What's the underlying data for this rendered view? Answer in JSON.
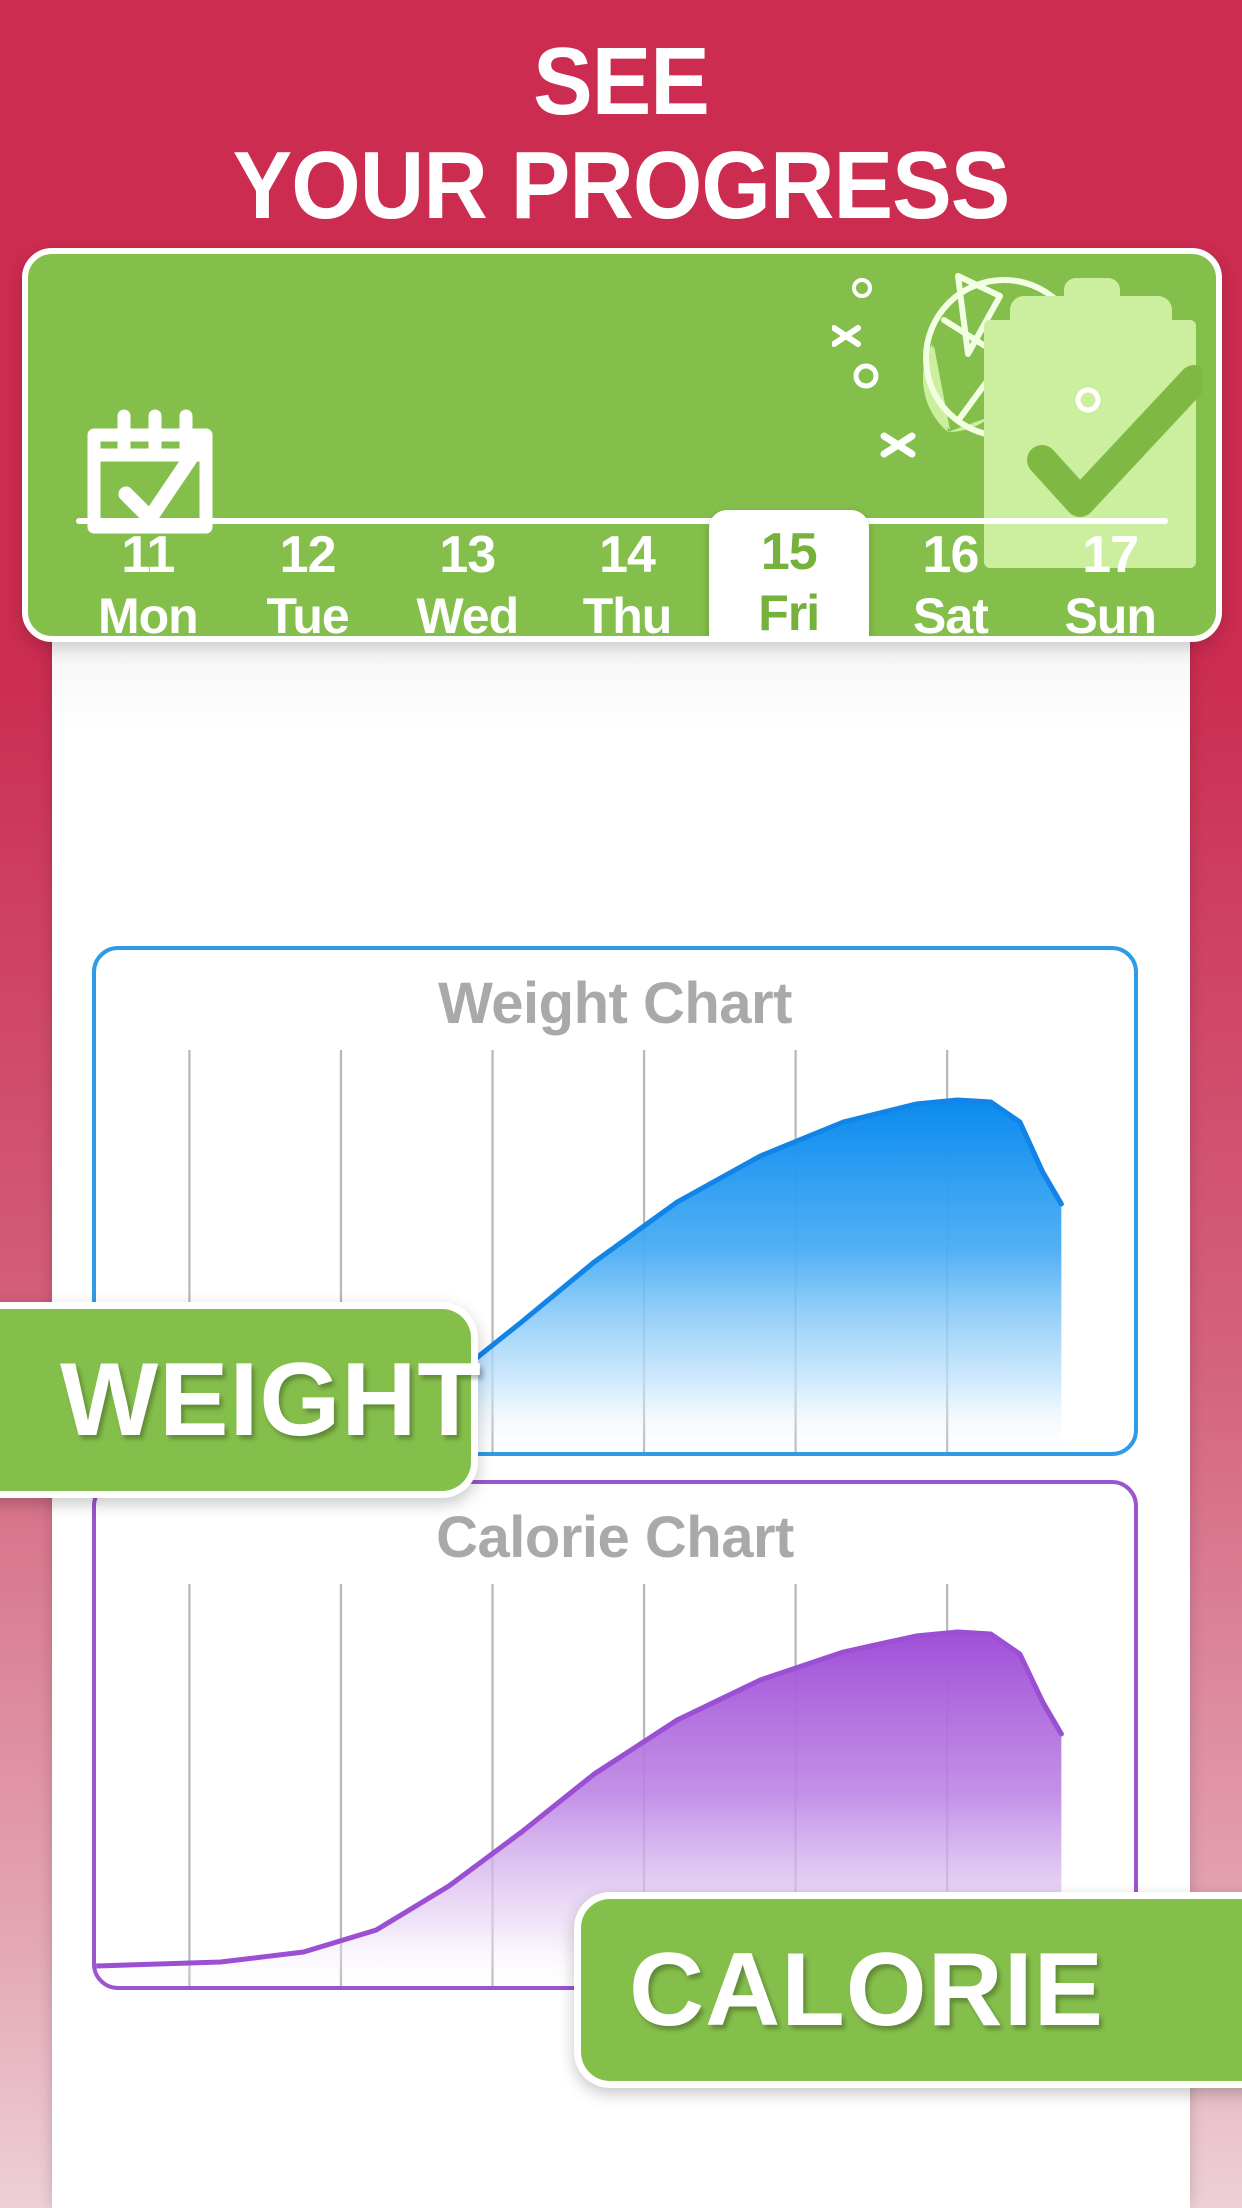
{
  "headline": {
    "line1": "SEE",
    "line2": "YOUR PROGRESS",
    "text": "SEE\nYOUR PROGRESS"
  },
  "colors": {
    "background_red": "#CB2C50",
    "brand_green": "#85BF4B",
    "weight_accent": "#2F9AE5",
    "calorie_accent": "#9B56CF",
    "chart_title_gray": "#A9A9A9",
    "card_white": "#FFFFFF",
    "selected_day_text": "#76B13C"
  },
  "calendar_card": {
    "icons": {
      "calendar_check": "calendar-check-icon",
      "pie_chart": "pie-chart-icon",
      "clipboard_check": "clipboard-check-icon",
      "sparkle_x_1": "sparkle-x-icon",
      "sparkle_x_2": "sparkle-x-icon",
      "sparkle_circle_1": "sparkle-circle-icon",
      "sparkle_circle_2": "sparkle-circle-icon",
      "sparkle_circle_3": "sparkle-circle-icon"
    },
    "selected_index": 4,
    "days": [
      {
        "num": "11",
        "name": "Mon",
        "selected": false
      },
      {
        "num": "12",
        "name": "Tue",
        "selected": false
      },
      {
        "num": "13",
        "name": "Wed",
        "selected": false
      },
      {
        "num": "14",
        "name": "Thu",
        "selected": false
      },
      {
        "num": "15",
        "name": "Fri",
        "selected": true
      },
      {
        "num": "16",
        "name": "Sat",
        "selected": false
      },
      {
        "num": "17",
        "name": "Sun",
        "selected": false
      }
    ]
  },
  "badges": {
    "weight": "WEIGHT",
    "calorie": "CALORIE"
  },
  "charts": [
    {
      "title": "Weight Chart"
    },
    {
      "title": "Calorie Chart"
    }
  ],
  "chart_data": [
    {
      "type": "area",
      "title": "Weight Chart",
      "xlabel": "",
      "ylabel": "",
      "grid": true,
      "gridlines_x": 6,
      "legend": "none",
      "accent_color": "#2F9AE5",
      "fill": "vertical gradient #0A8BEF to transparent",
      "xlim": [
        0,
        100
      ],
      "ylim": [
        0,
        100
      ],
      "x": [
        0,
        10,
        20,
        30,
        40,
        50,
        60,
        70,
        80,
        88,
        93,
        96,
        100
      ],
      "values": [
        0,
        0,
        1,
        4,
        16,
        38,
        58,
        74,
        86,
        92,
        90,
        70,
        62
      ]
    },
    {
      "type": "area",
      "title": "Calorie Chart",
      "xlabel": "",
      "ylabel": "",
      "grid": true,
      "gridlines_x": 6,
      "legend": "none",
      "accent_color": "#9B56CF",
      "fill": "vertical gradient #A14FD8 to transparent",
      "xlim": [
        0,
        100
      ],
      "ylim": [
        0,
        100
      ],
      "x": [
        0,
        10,
        20,
        30,
        40,
        50,
        60,
        70,
        80,
        88,
        93,
        96,
        100
      ],
      "values": [
        6,
        7,
        9,
        14,
        26,
        45,
        62,
        76,
        86,
        90,
        88,
        68,
        60
      ]
    }
  ]
}
